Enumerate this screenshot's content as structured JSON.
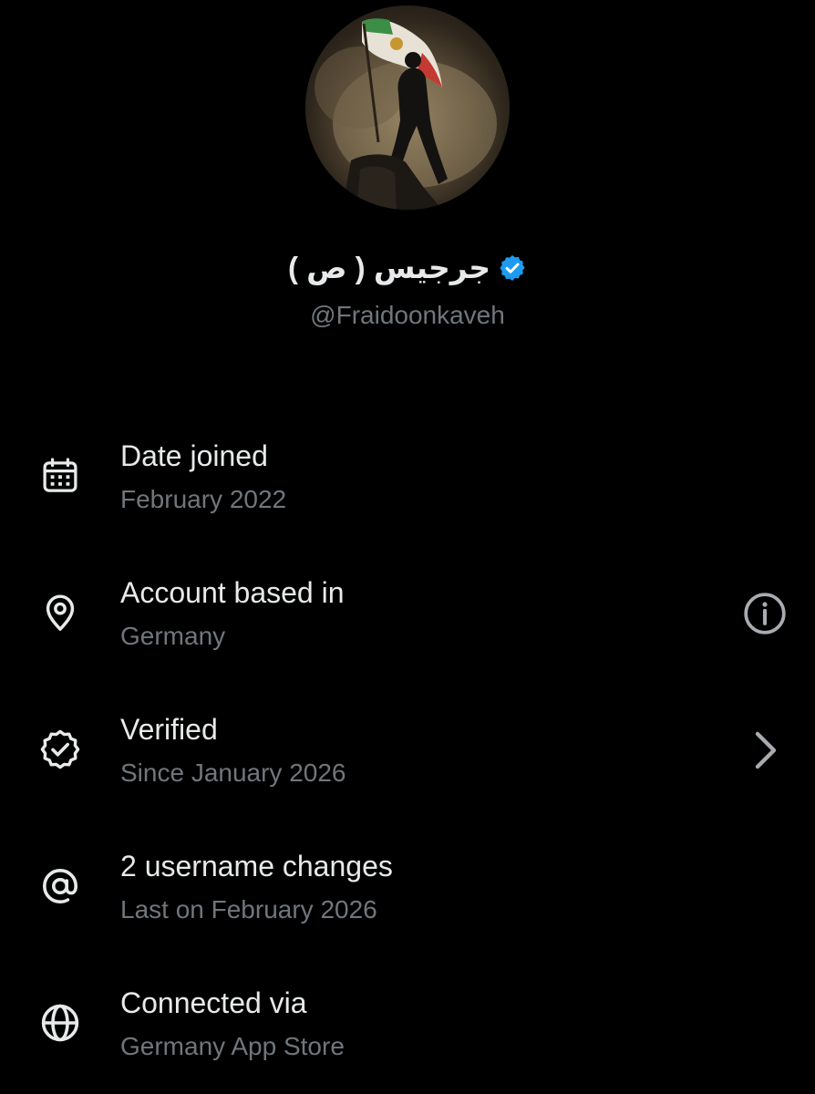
{
  "profile": {
    "avatar_alt": "profile-photo",
    "display_name": "جرجیس ( ص )",
    "handle": "@Fraidoonkaveh",
    "verified_color": "#1d9bf0"
  },
  "about": {
    "items": [
      {
        "icon": "calendar-icon",
        "title": "Date joined",
        "subtitle": "February 2022"
      },
      {
        "icon": "location-pin-icon",
        "title": "Account based in",
        "subtitle": "Germany",
        "trailing": "info-icon"
      },
      {
        "icon": "verified-badge-icon",
        "title": "Verified",
        "subtitle": "Since January 2026",
        "trailing": "chevron-right-icon"
      },
      {
        "icon": "at-sign-icon",
        "title": "2 username changes",
        "subtitle": "Last on February 2026"
      },
      {
        "icon": "globe-icon",
        "title": "Connected via",
        "subtitle": "Germany App Store"
      }
    ]
  },
  "colors": {
    "background": "#000000",
    "primary_text": "#e7e9ea",
    "secondary_text": "#71767b",
    "accent": "#1d9bf0"
  }
}
